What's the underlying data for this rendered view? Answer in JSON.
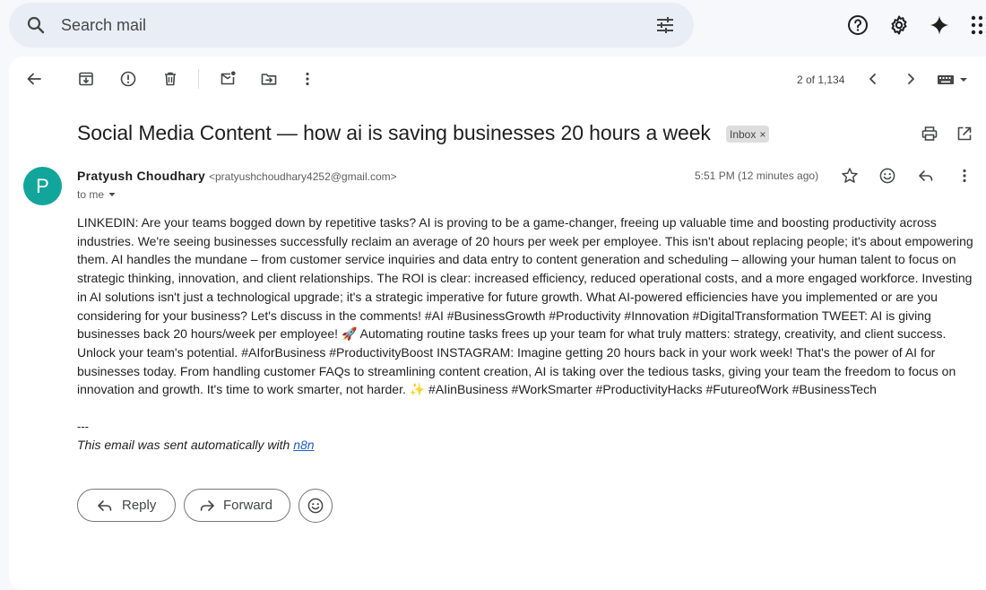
{
  "search": {
    "placeholder": "Search mail"
  },
  "toolbar": {
    "pager": "2 of 1,134"
  },
  "email": {
    "subject": "Social Media Content — how ai is saving businesses 20 hours a week",
    "label": "Inbox",
    "label_close": "×",
    "avatar_letter": "P",
    "sender_name": "Pratyush Choudhary",
    "sender_email": "<pratyushchoudhary4252@gmail.com>",
    "recipient": "to me",
    "time": "5:51 PM (12 minutes ago)",
    "body": "LINKEDIN: Are your teams bogged down by repetitive tasks? AI is proving to be a game-changer, freeing up valuable time and boosting productivity across industries. We're seeing businesses successfully reclaim an average of 20 hours per week per employee. This isn't about replacing people; it's about empowering them. AI handles the mundane – from customer service inquiries and data entry to content generation and scheduling – allowing your human talent to focus on strategic thinking, innovation, and client relationships. The ROI is clear: increased efficiency, reduced operational costs, and a more engaged workforce. Investing in AI solutions isn't just a technological upgrade; it's a strategic imperative for future growth. What AI-powered efficiencies have you implemented or are you considering for your business? Let's discuss in the comments! #AI #BusinessGrowth #Productivity #Innovation #DigitalTransformation TWEET: AI is giving businesses back 20 hours/week per employee! 🚀 Automating routine tasks frees up your team for what truly matters: strategy, creativity, and client success. Unlock your team's potential. #AIforBusiness #ProductivityBoost INSTAGRAM: Imagine getting 20 hours back in your work week! That's the power of AI for businesses today. From handling customer FAQs to streamlining content creation, AI is taking over the tedious tasks, giving your team the freedom to focus on innovation and growth. It's time to work smarter, not harder. ✨ #AIinBusiness #WorkSmarter #ProductivityHacks #FutureofWork #BusinessTech",
    "signature_separator": "---",
    "signature_text": "This email was sent automatically with ",
    "signature_link": "n8n"
  },
  "actions": {
    "reply": "Reply",
    "forward": "Forward"
  },
  "icons": {
    "search": "search-icon",
    "tune": "tune-icon",
    "help": "help-icon",
    "settings": "gear-icon",
    "gemini": "sparkle-icon",
    "apps": "apps-grid-icon"
  },
  "colors": {
    "avatar": "#12a59b",
    "link": "#1a5fc8",
    "search_bg": "#e9eef6",
    "page_bg": "#f6f8fc"
  }
}
